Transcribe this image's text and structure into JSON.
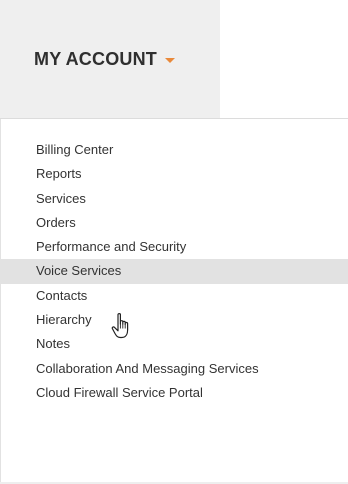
{
  "nav": {
    "account_menu_label": "MY ACCOUNT",
    "caret_icon": "caret-down-icon",
    "accent_color": "#e9893a"
  },
  "menu": {
    "items": [
      {
        "label": "Billing Center"
      },
      {
        "label": "Reports"
      },
      {
        "label": "Services"
      },
      {
        "label": "Orders"
      },
      {
        "label": "Performance and Security"
      },
      {
        "label": "Voice Services",
        "hovered": true
      },
      {
        "label": "Contacts"
      },
      {
        "label": "Hierarchy"
      },
      {
        "label": "Notes"
      },
      {
        "label": "Collaboration And Messaging Services"
      },
      {
        "label": "Cloud Firewall Service Portal"
      }
    ],
    "hover_background": "#e2e2e2"
  },
  "cursor": {
    "icon": "hand-pointer-icon"
  }
}
